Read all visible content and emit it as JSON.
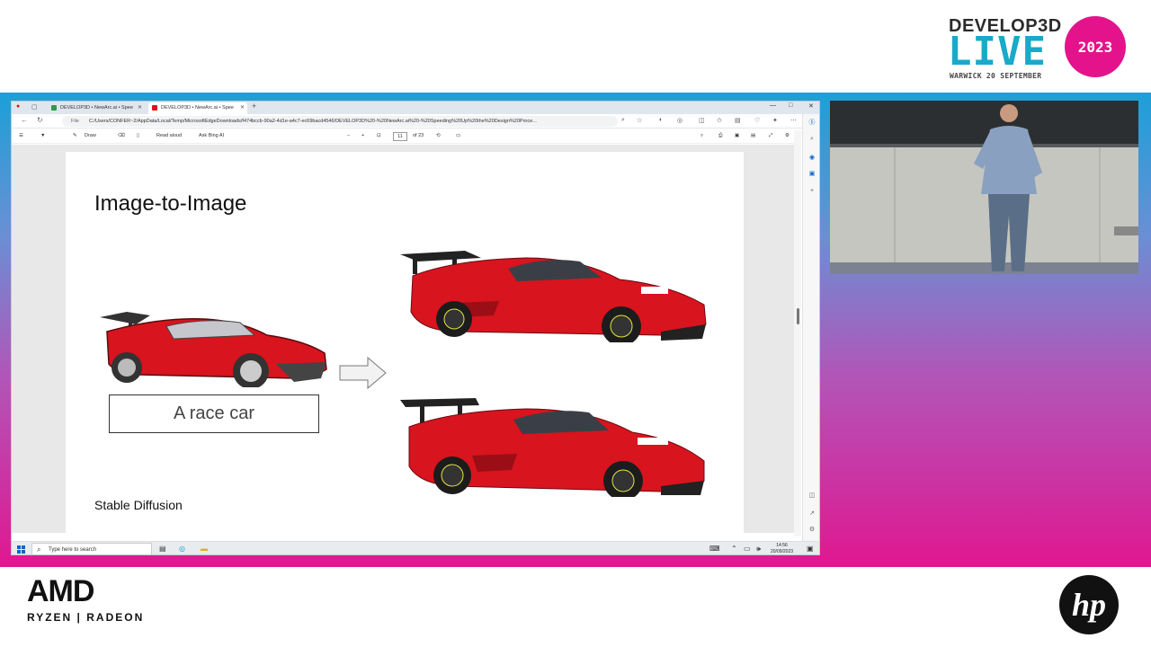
{
  "event": {
    "name": "DEVELOP3D",
    "live": "LIVE",
    "year": "2023",
    "subtitle": "WARWICK 20 SEPTEMBER"
  },
  "browser": {
    "tabs": [
      {
        "label": "DEVELOP3D • NewArc.ai • Spee",
        "active": false
      },
      {
        "label": "DEVELOP3D • NewArc.ai • Spee",
        "active": true
      }
    ],
    "new_tab": "+",
    "window_controls": [
      "—",
      "□",
      "✕"
    ],
    "address_prefix": "File",
    "url": "C:/Users/CONFER~2/AppData/Local/Temp/MicrosoftEdgeDownloads/f474bccb-90a2-4d1e-a4c7-ec69bacd4546/DEVELOP3D%20-%20NewArc.ai%20-%20Speeding%20Up%20the%20Design%20Proce..."
  },
  "pdf_toolbar": {
    "draw": "Draw",
    "read_aloud": "Read aloud",
    "ask_bing": "Ask Bing AI",
    "page_current": "11",
    "page_total": "of 23"
  },
  "slide": {
    "title": "Image-to-Image",
    "prompt": "A race car",
    "footer": "Stable Diffusion"
  },
  "taskbar": {
    "search_placeholder": "Type here to search",
    "time": "14:56",
    "date": "20/09/2023"
  },
  "sponsors": {
    "amd": "AMD",
    "amd_sub": "RYZEN | RADEON",
    "hp": "hp"
  },
  "colors": {
    "accent_pink": "#e4138b",
    "accent_cyan": "#19a9c9",
    "car_red": "#d8141e"
  }
}
